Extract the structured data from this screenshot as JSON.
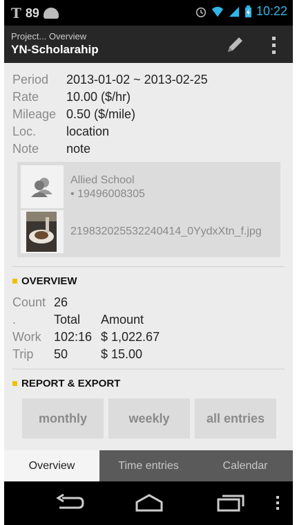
{
  "status_bar": {
    "app_badge": "T",
    "battery_percent": "89",
    "time": "10:22"
  },
  "action_bar": {
    "subtitle": "Project... Overview",
    "title": "YN-Scholarahip"
  },
  "details": [
    {
      "label": "Period",
      "value": "2013-01-02 ~ 2013-02-25"
    },
    {
      "label": "Rate",
      "value": "10.00 ($/hr)"
    },
    {
      "label": "Mileage",
      "value": "0.50 ($/mile)"
    },
    {
      "label": "Loc.",
      "value": "location"
    },
    {
      "label": "Note",
      "value": "note"
    }
  ],
  "contact": {
    "name": "Allied School",
    "phone": "• 19496008305"
  },
  "attachment": {
    "filename": "219832025532240414_0YydxXtn_f.jpg"
  },
  "overview": {
    "heading": "OVERVIEW",
    "count_label": "Count",
    "count_value": "26",
    "header_blank": ".",
    "header_total": "Total",
    "header_amount": "Amount",
    "rows": [
      {
        "label": "Work",
        "total": "102:16",
        "amount": "$ 1,022.67"
      },
      {
        "label": "Trip",
        "total": "50",
        "amount": "$ 15.00"
      }
    ]
  },
  "report": {
    "heading": "REPORT & EXPORT",
    "buttons": [
      "monthly",
      "weekly",
      "all entries"
    ]
  },
  "tabs": [
    "Overview",
    "Time entries",
    "Calendar"
  ],
  "colors": {
    "accent_square": "#f0c000",
    "clock_blue": "#33b5e5",
    "action_bar": "#272727"
  }
}
